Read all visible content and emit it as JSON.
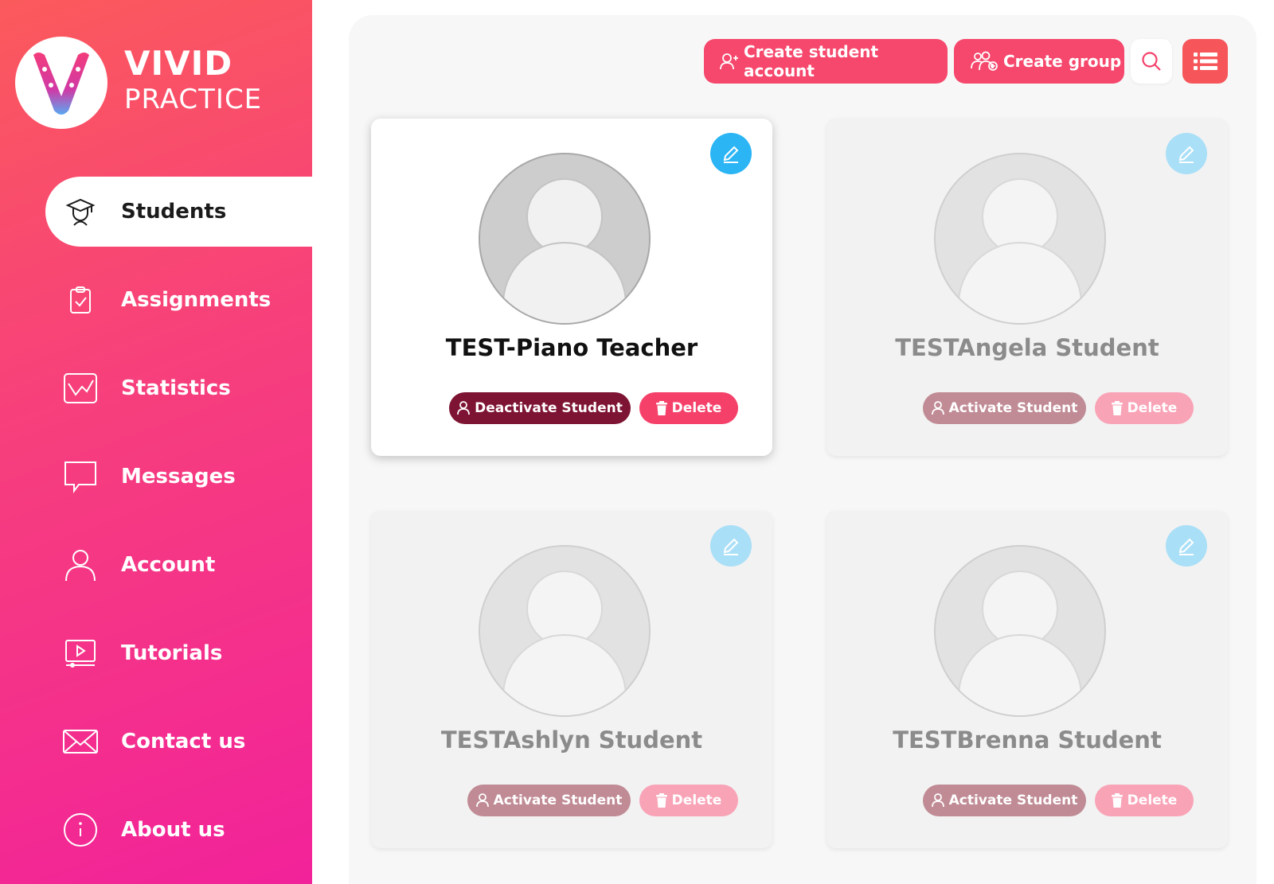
{
  "brand": {
    "line1": "VIVID",
    "line2": "PRACTICE"
  },
  "nav": [
    {
      "label": "Students",
      "icon": "graduation-cap-icon",
      "active": true
    },
    {
      "label": "Assignments",
      "icon": "clipboard-check-icon"
    },
    {
      "label": "Statistics",
      "icon": "chart-icon"
    },
    {
      "label": "Messages",
      "icon": "message-bubble-icon"
    },
    {
      "label": "Account",
      "icon": "user-icon"
    },
    {
      "label": "Tutorials",
      "icon": "video-play-icon"
    },
    {
      "label": "Contact us",
      "icon": "envelope-icon"
    },
    {
      "label": "About us",
      "icon": "info-icon"
    }
  ],
  "toolbar": {
    "create_student_label": "Create student account",
    "create_group_label": "Create group"
  },
  "cards": [
    {
      "name": "TEST-Piano Teacher",
      "action_label": "Deactivate Student",
      "delete_label": "Delete",
      "active": true
    },
    {
      "name": "TESTAngela Student",
      "action_label": "Activate Student",
      "delete_label": "Delete",
      "active": false
    },
    {
      "name": "TESTAshlyn Student",
      "action_label": "Activate Student",
      "delete_label": "Delete",
      "active": false
    },
    {
      "name": "TESTBrenna Student",
      "action_label": "Activate Student",
      "delete_label": "Delete",
      "active": false
    }
  ],
  "colors": {
    "sidebar_gradient_start": "#fb5a5c",
    "sidebar_gradient_end": "#f2229a",
    "primary_button": "#f6476c",
    "deactivate_button": "#7e1433",
    "edit_button": "#2bb5f5"
  }
}
